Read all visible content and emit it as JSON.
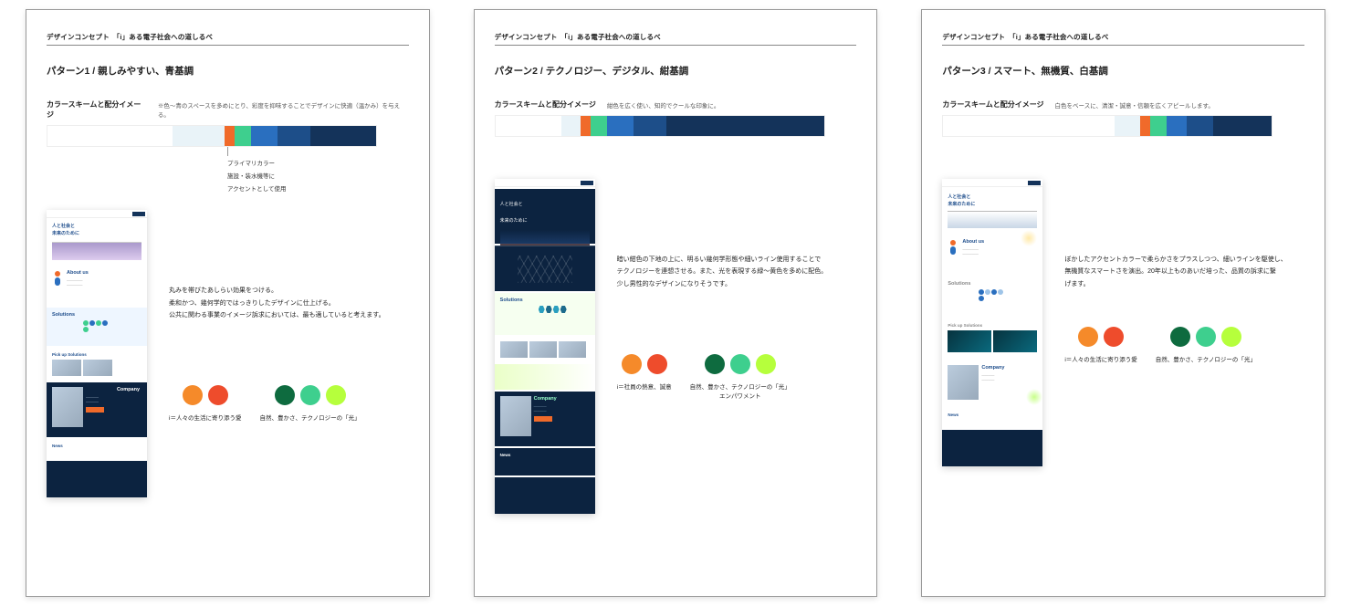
{
  "design_concept": "デザインコンセプト　「i」ある電子社会への道しるべ",
  "color_scheme_label": "カラースキームと配分イメージ",
  "mock_sections": {
    "hero_line1": "人と社会と",
    "hero_line2": "未来のために",
    "about": "About us",
    "solutions": "Solutions",
    "pickup": "Pick up Solutions",
    "company": "Company",
    "news": "News"
  },
  "bar_colors": {
    "white": "#ffffff",
    "pale": "#e9f3f8",
    "orange": "#f06a2a",
    "green": "#3ecf8e",
    "blue": "#2a6fbf",
    "mid": "#1d4e89",
    "navy": "#14335a"
  },
  "patterns": [
    {
      "title": "パターン1  /  親しみやすい、青基調",
      "cs_note": "※色〜青のスペースを多めにとり、彩度を抑味することでデザインに快適（温かみ）を与える。",
      "bar_ratios": [
        38,
        16,
        3,
        5,
        8,
        10,
        20
      ],
      "primary_anno": [
        "プライマリカラー",
        "施設・装水機等に",
        "アクセントとして使用"
      ],
      "desc": [
        "丸みを帯びたあしらい効果をつける。",
        "柔和かつ、幾何学的ではっきりしたデザインに仕上げる。",
        "公共に関わる事業のイメージ訴求においては、最も適していると考えます。"
      ],
      "swatches": {
        "left": {
          "colors": [
            "#f58a2a",
            "#ee4c2c"
          ],
          "label": "i＝人々の生活に寄り添う愛"
        },
        "right": {
          "colors": [
            "#0e6b3f",
            "#3ecf8e",
            "#b6ff3c"
          ],
          "label": "自然、豊かさ、テクノロジーの「光」"
        }
      }
    },
    {
      "title": "パターン2  /  テクノロジー、デジタル、紺基調",
      "cs_note": "紺色を広く使い、知的でクールな印象に。",
      "bar_ratios": [
        20,
        6,
        3,
        5,
        8,
        10,
        48
      ],
      "desc": [
        "暗い紺色の下地の上に、明るい幾何学形態や細いライン使用することで",
        "テクノロジーを連想させる。また、光を表現する緑〜黄色を多めに配色。",
        "少し男性的なデザインになりそうです。"
      ],
      "swatches": {
        "left": {
          "colors": [
            "#f58a2a",
            "#ee4c2c"
          ],
          "label": "i＝社員の熱意、誠意"
        },
        "right": {
          "colors": [
            "#0e6b3f",
            "#3ecf8e",
            "#b6ff3c"
          ],
          "label": "自然、豊かさ、テクノロジーの「光」\nエンパワメント"
        }
      }
    },
    {
      "title": "パターン3  /  スマート、無機質、白基調",
      "cs_note": "白色をベースに、清潔・誠意・信頼を広くアピールします。",
      "bar_ratios": [
        52,
        8,
        3,
        5,
        6,
        8,
        18
      ],
      "desc": [
        "ぼかしたアクセントカラーで柔らかさをプラスしつつ、細いラインを駆使し、",
        "無機質なスマートさを演出。20年以上ものあいだ培った、品質の訴求に繋",
        "げます。"
      ],
      "swatches": {
        "left": {
          "colors": [
            "#f58a2a",
            "#ee4c2c"
          ],
          "label": "i＝人々の生活に寄り添う愛"
        },
        "right": {
          "colors": [
            "#0e6b3f",
            "#3ecf8e",
            "#b6ff3c"
          ],
          "label": "自然、豊かさ、テクノロジーの「光」"
        }
      }
    }
  ]
}
